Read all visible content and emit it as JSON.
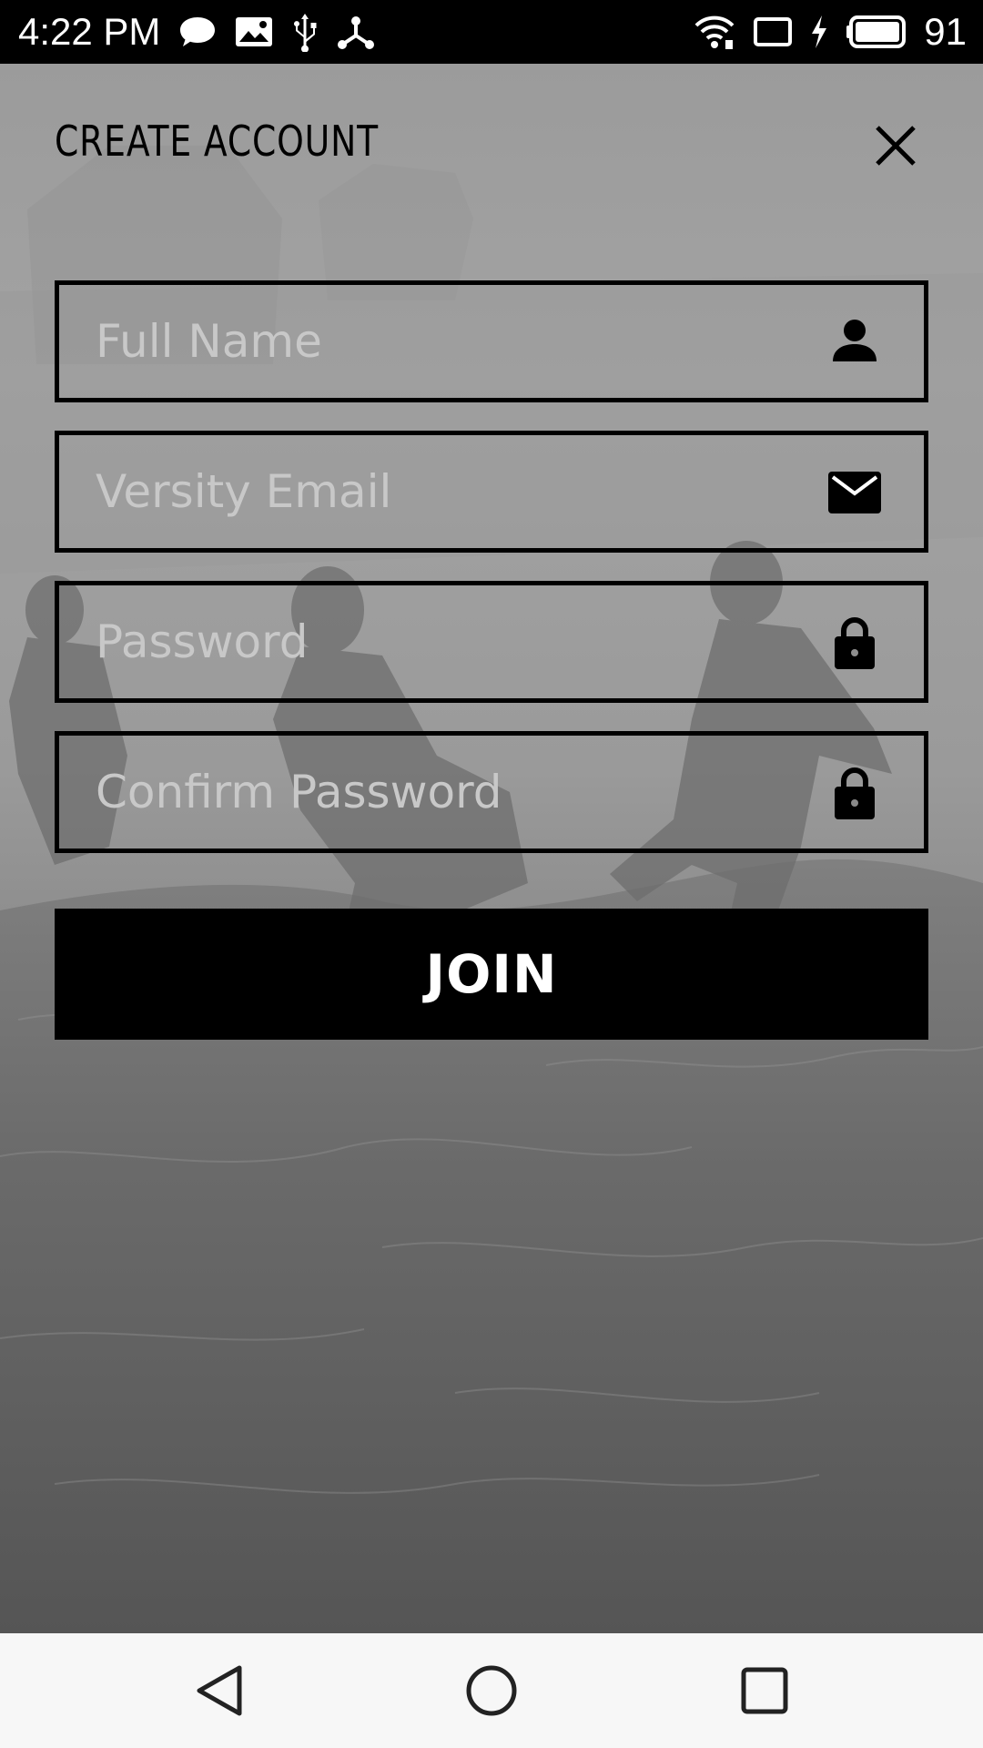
{
  "status_bar": {
    "time": "4:22 PM",
    "battery_level": "91",
    "left_icons": [
      "chat-bubble-icon",
      "image-notification-icon",
      "usb-icon",
      "network-share-icon"
    ],
    "right_icons": [
      "wifi-icon",
      "cast-icon",
      "charging-icon",
      "battery-icon"
    ]
  },
  "header": {
    "title": "CREATE ACCOUNT",
    "close_icon": "close-icon"
  },
  "form": {
    "full_name": {
      "placeholder": "Full Name",
      "value": "",
      "icon": "person-icon"
    },
    "email": {
      "placeholder": "Versity Email",
      "value": "",
      "icon": "mail-icon"
    },
    "password": {
      "placeholder": "Password",
      "value": "",
      "icon": "lock-icon"
    },
    "confirm_password": {
      "placeholder": "Confirm Password",
      "value": "",
      "icon": "lock-icon"
    },
    "submit_label": "JOIN"
  },
  "nav_bar": {
    "icons": [
      "back-icon",
      "home-icon",
      "recents-icon"
    ]
  },
  "colors": {
    "status_bar_bg": "#000000",
    "field_border": "#000000",
    "placeholder_text": "#c8c8c8",
    "button_bg": "#000000",
    "button_text": "#ffffff",
    "nav_bar_bg": "#f7f7f7"
  }
}
